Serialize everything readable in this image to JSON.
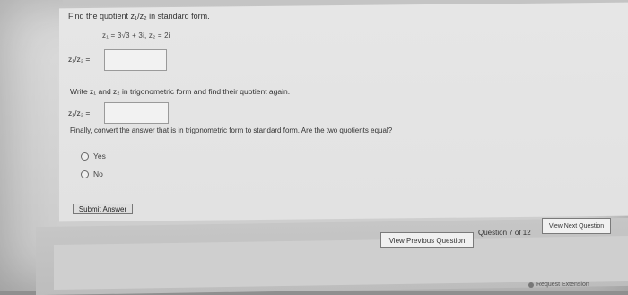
{
  "question": {
    "prompt": "Find the quotient z₁/z₂ in standard form.",
    "given": "z₁ = 3√3 + 3i, z₂ = 2i",
    "answer1_label": "z₁/z₂ =",
    "answer1_value": "",
    "instruction2": "Write z₁ and z₂ in trigonometric form and find their quotient again.",
    "answer2_label": "z₁/z₂ =",
    "answer2_value": "",
    "instruction3": "Finally, convert the answer that is in trigonometric form to standard form. Are the two quotients equal?",
    "options": [
      "Yes",
      "No"
    ],
    "submit_label": "Submit Answer"
  },
  "navigation": {
    "previous_label": "View Previous Question",
    "counter": "Question 7 of 12",
    "next_label": "View Next Question"
  },
  "footer": {
    "extension_label": "Request Extension"
  }
}
